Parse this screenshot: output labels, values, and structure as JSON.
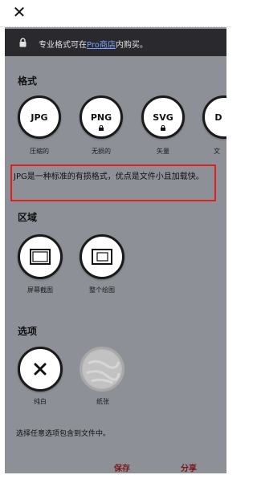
{
  "banner": {
    "pre": "专业格式可在",
    "link": "Pro商店",
    "post": "内购买。"
  },
  "format": {
    "title": "格式",
    "options": [
      {
        "label": "JPG",
        "caption": "压缩的"
      },
      {
        "label": "PNG",
        "caption": "无损的"
      },
      {
        "label": "SVG",
        "caption": "矢量"
      },
      {
        "label": "D",
        "caption": "文"
      }
    ],
    "description": "JPG是一种标准的有损格式，优点是文件小且加载快。"
  },
  "region": {
    "title": "区域",
    "options": [
      {
        "caption": "屏幕截图"
      },
      {
        "caption": "整个绘图"
      }
    ]
  },
  "options": {
    "title": "选项",
    "items": [
      {
        "caption": "纯白"
      },
      {
        "caption": "纸张"
      }
    ],
    "note": "选择任意选项包含到文件中。"
  },
  "actions": {
    "save": "保存",
    "share": "分享"
  }
}
